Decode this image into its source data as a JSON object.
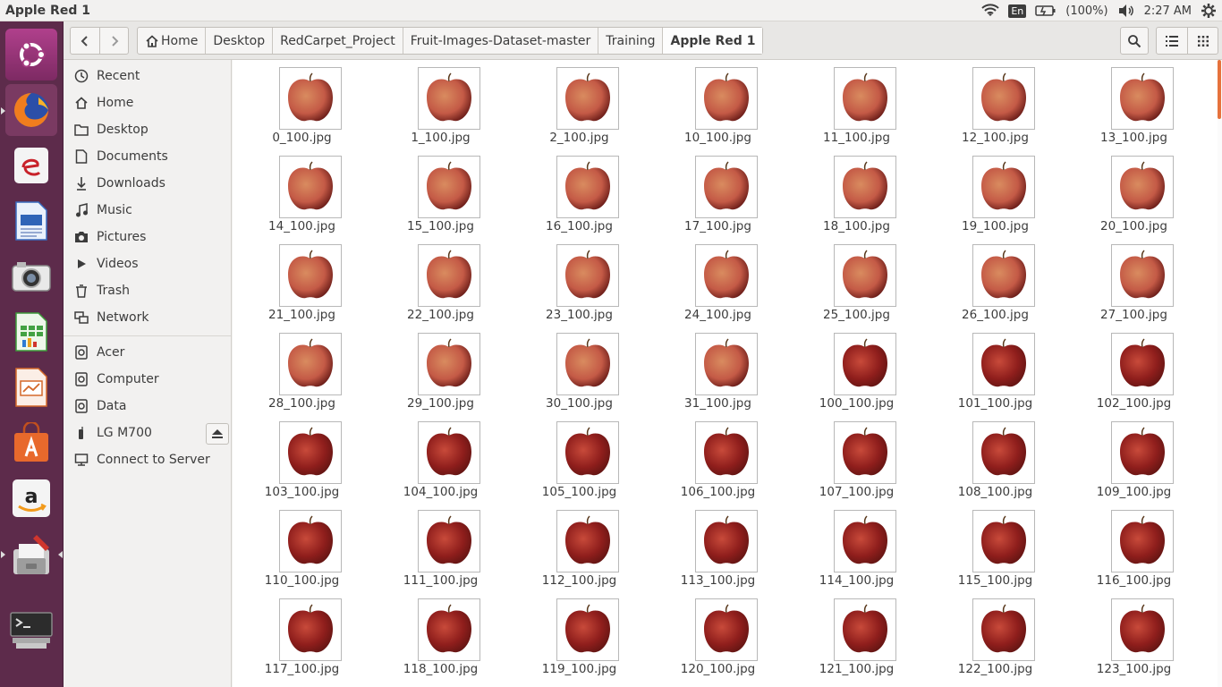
{
  "window": {
    "title": "Apple Red 1"
  },
  "panel": {
    "keyboard_layout": "En",
    "battery_percent": "(100%)",
    "time": "2:27 AM"
  },
  "toolbar": {
    "breadcrumbs": [
      "Home",
      "Desktop",
      "RedCarpet_Project",
      "Fruit-Images-Dataset-master",
      "Training",
      "Apple Red 1"
    ]
  },
  "sidebar": {
    "places": [
      {
        "label": "Recent",
        "icon": "clock-icon"
      },
      {
        "label": "Home",
        "icon": "home-icon"
      },
      {
        "label": "Desktop",
        "icon": "folder-icon"
      },
      {
        "label": "Documents",
        "icon": "document-icon"
      },
      {
        "label": "Downloads",
        "icon": "download-icon"
      },
      {
        "label": "Music",
        "icon": "music-icon"
      },
      {
        "label": "Pictures",
        "icon": "camera-icon"
      },
      {
        "label": "Videos",
        "icon": "video-icon"
      },
      {
        "label": "Trash",
        "icon": "trash-icon"
      },
      {
        "label": "Network",
        "icon": "network-icon"
      }
    ],
    "devices": [
      {
        "label": "Acer",
        "icon": "drive-icon"
      },
      {
        "label": "Computer",
        "icon": "drive-icon"
      },
      {
        "label": "Data",
        "icon": "drive-icon"
      },
      {
        "label": "LG M700",
        "icon": "phone-icon"
      },
      {
        "label": "Connect to Server",
        "icon": "server-icon"
      }
    ]
  },
  "files": [
    "0_100.jpg",
    "1_100.jpg",
    "2_100.jpg",
    "10_100.jpg",
    "11_100.jpg",
    "12_100.jpg",
    "13_100.jpg",
    "14_100.jpg",
    "15_100.jpg",
    "16_100.jpg",
    "17_100.jpg",
    "18_100.jpg",
    "19_100.jpg",
    "20_100.jpg",
    "21_100.jpg",
    "22_100.jpg",
    "23_100.jpg",
    "24_100.jpg",
    "25_100.jpg",
    "26_100.jpg",
    "27_100.jpg",
    "28_100.jpg",
    "29_100.jpg",
    "30_100.jpg",
    "31_100.jpg",
    "100_100.jpg",
    "101_100.jpg",
    "102_100.jpg",
    "103_100.jpg",
    "104_100.jpg",
    "105_100.jpg",
    "106_100.jpg",
    "107_100.jpg",
    "108_100.jpg",
    "109_100.jpg",
    "110_100.jpg",
    "111_100.jpg",
    "112_100.jpg",
    "113_100.jpg",
    "114_100.jpg",
    "115_100.jpg",
    "116_100.jpg",
    "117_100.jpg",
    "118_100.jpg",
    "119_100.jpg",
    "120_100.jpg",
    "121_100.jpg",
    "122_100.jpg",
    "123_100.jpg"
  ],
  "colors": {
    "launcher_bg": "#5d2b4b",
    "accent_scroll": "#e6723c",
    "apple_light": "#c45a46",
    "apple_dark": "#8f1e1c"
  }
}
